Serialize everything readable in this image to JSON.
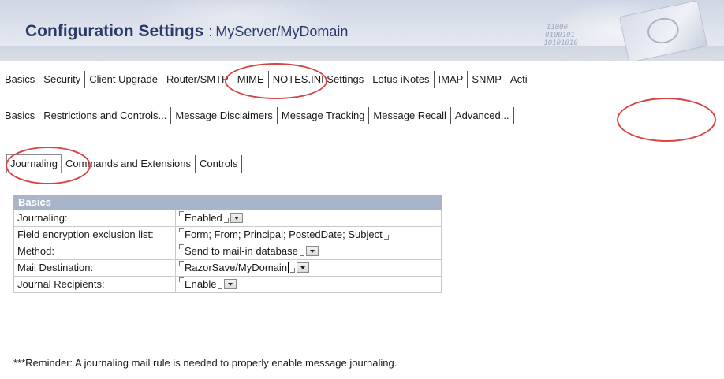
{
  "header": {
    "title": "Configuration Settings",
    "separator": ":",
    "subtitle": "MyServer/MyDomain",
    "decor_binary": "11000\n0100101\n10101010"
  },
  "tabs_level1": [
    "Basics",
    "Security",
    "Client Upgrade",
    "Router/SMTP",
    "MIME",
    "NOTES.INI Settings",
    "Lotus iNotes",
    "IMAP",
    "SNMP",
    "Acti"
  ],
  "tabs_level2": [
    "Basics",
    "Restrictions and Controls...",
    "Message Disclaimers",
    "Message Tracking",
    "Message Recall",
    "Advanced..."
  ],
  "tabs_level3": [
    "Journaling",
    "Commands and Extensions",
    "Controls"
  ],
  "basics_section": {
    "heading": "Basics",
    "rows": [
      {
        "label": "Journaling:",
        "value": "Enabled"
      },
      {
        "label": "Field encryption exclusion list:",
        "value": "Form; From; Principal; PostedDate; Subject"
      },
      {
        "label": "Method:",
        "value": "Send to mail-in database"
      },
      {
        "label": "Mail Destination:",
        "value": "RazorSave/MyDomain"
      },
      {
        "label": "Journal Recipients:",
        "value": "Enable"
      }
    ]
  },
  "reminder": "***Reminder:  A journaling mail rule is needed to properly enable message journaling.",
  "colors": {
    "title": "#2a3a6b",
    "section_header_bg": "#a9b4c8",
    "annotation": "#d64545"
  }
}
